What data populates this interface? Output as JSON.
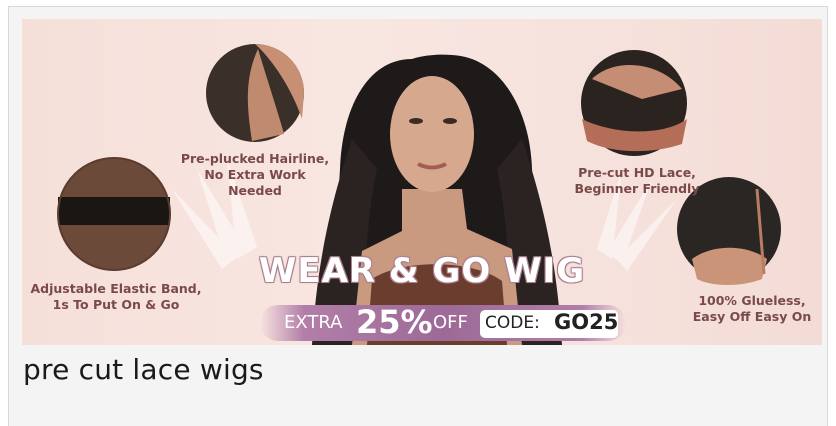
{
  "banner": {
    "features": [
      {
        "line1": "Pre-plucked Hairline,",
        "line2": "No Extra Work Needed"
      },
      {
        "line1": "Adjustable Elastic Band,",
        "line2": "1s To Put On & Go"
      },
      {
        "line1": "Pre-cut HD Lace,",
        "line2": "Beginner Friendly"
      },
      {
        "line1": "100% Glueless,",
        "line2": "Easy Off Easy On"
      }
    ],
    "headline": "WEAR & GO WIG",
    "promo": {
      "extra": "EXTRA",
      "percent": "25%",
      "off": "OFF",
      "code_label": "CODE:",
      "code_value": "GO25"
    }
  },
  "caption": "pre cut lace wigs",
  "colors": {
    "banner_bg": "#f7e3de",
    "feature_text": "#7a4a48",
    "promo_bar": "#9d6a97",
    "card_bg": "#f4f4f4"
  }
}
